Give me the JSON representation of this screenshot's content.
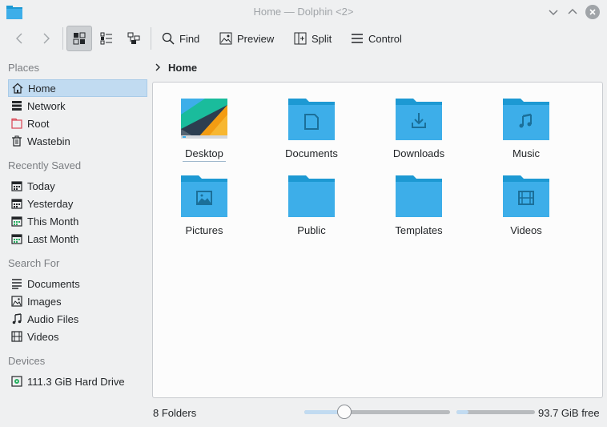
{
  "window": {
    "title": "Home — Dolphin <2>"
  },
  "toolbar": {
    "find_label": "Find",
    "preview_label": "Preview",
    "split_label": "Split",
    "control_label": "Control"
  },
  "sidebar": {
    "places": {
      "title": "Places",
      "items": [
        {
          "label": "Home",
          "icon": "home-icon",
          "selected": true
        },
        {
          "label": "Network",
          "icon": "network-icon"
        },
        {
          "label": "Root",
          "icon": "root-folder-icon"
        },
        {
          "label": "Wastebin",
          "icon": "trash-icon"
        }
      ]
    },
    "recent": {
      "title": "Recently Saved",
      "items": [
        {
          "label": "Today",
          "icon": "calendar-icon"
        },
        {
          "label": "Yesterday",
          "icon": "calendar-icon"
        },
        {
          "label": "This Month",
          "icon": "calendar-icon"
        },
        {
          "label": "Last Month",
          "icon": "calendar-icon"
        }
      ]
    },
    "search": {
      "title": "Search For",
      "items": [
        {
          "label": "Documents",
          "icon": "document-list-icon"
        },
        {
          "label": "Images",
          "icon": "image-icon"
        },
        {
          "label": "Audio Files",
          "icon": "music-note-icon"
        },
        {
          "label": "Videos",
          "icon": "film-icon"
        }
      ]
    },
    "devices": {
      "title": "Devices",
      "items": [
        {
          "label": "111.3 GiB Hard Drive",
          "icon": "hard-drive-icon"
        }
      ]
    }
  },
  "breadcrumb": {
    "current": "Home"
  },
  "files": [
    {
      "label": "Desktop",
      "icon": "desktop-folder-icon"
    },
    {
      "label": "Documents",
      "icon": "documents-folder-icon"
    },
    {
      "label": "Downloads",
      "icon": "downloads-folder-icon"
    },
    {
      "label": "Music",
      "icon": "music-folder-icon"
    },
    {
      "label": "Pictures",
      "icon": "pictures-folder-icon"
    },
    {
      "label": "Public",
      "icon": "folder-icon"
    },
    {
      "label": "Templates",
      "icon": "folder-icon"
    },
    {
      "label": "Videos",
      "icon": "videos-folder-icon"
    }
  ],
  "status": {
    "folder_count": "8 Folders",
    "free_space": "93.7 GiB free",
    "zoom_fraction": 0.27,
    "used_fraction": 0.15
  },
  "colors": {
    "accent": "#3daee9",
    "folder_body": "#3daee9",
    "folder_tab": "#1d99d3",
    "selection": "#c1dbf1"
  }
}
